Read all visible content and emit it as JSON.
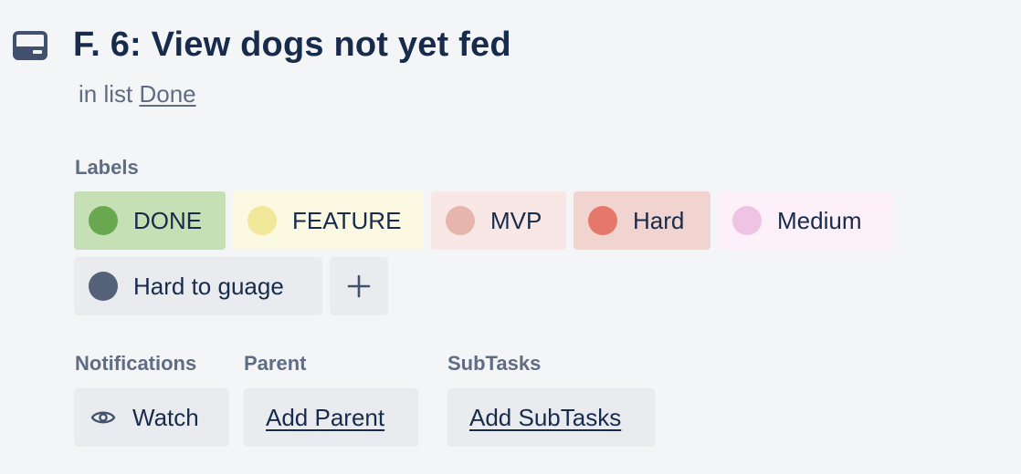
{
  "card": {
    "title": "F. 6: View dogs not yet fed",
    "in_list_prefix": "in list",
    "list_name": "Done"
  },
  "labels_section": {
    "heading": "Labels",
    "items": [
      {
        "label": "DONE",
        "dot_color": "#6aa84f",
        "bg_color": "#c5e0b4"
      },
      {
        "label": "FEATURE",
        "dot_color": "#f2e899",
        "bg_color": "#fcf9e3"
      },
      {
        "label": "MVP",
        "dot_color": "#e6b5ab",
        "bg_color": "#f8e7e4"
      },
      {
        "label": "Hard",
        "dot_color": "#e5786a",
        "bg_color": "#f1d4cf"
      },
      {
        "label": "Medium",
        "dot_color": "#eec3e3",
        "bg_color": "#fdf0f8"
      },
      {
        "label": "Hard to guage",
        "dot_color": "#546178",
        "bg_color": "#e9ebee"
      }
    ],
    "add_icon": "plus-icon"
  },
  "notifications": {
    "heading": "Notifications",
    "watch_label": "Watch",
    "watch_icon": "eye-icon"
  },
  "parent": {
    "heading": "Parent",
    "add_label": "Add Parent"
  },
  "subtasks": {
    "heading": "SubTasks",
    "add_label": "Add SubTasks"
  },
  "colors": {
    "background": "#f4f5f7",
    "text_primary": "#172b4d",
    "text_secondary": "#5e6c84",
    "button_bg": "#e9ebee"
  }
}
